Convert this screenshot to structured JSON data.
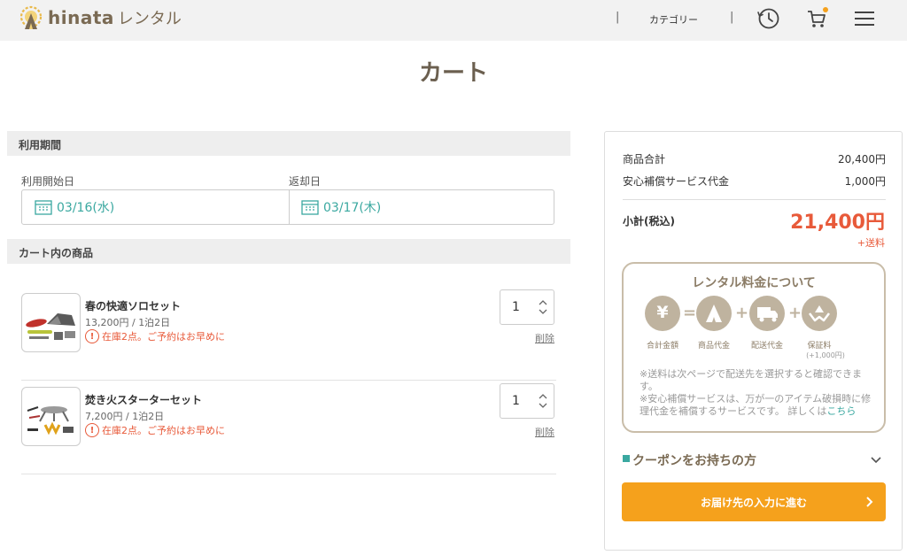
{
  "header": {
    "logo_text": "hinata",
    "logo_sub": "レンタル",
    "separator": "|",
    "category_label": "カテゴリー"
  },
  "page_title": "カート",
  "period": {
    "section_title": "利用期間",
    "start_label": "利用開始日",
    "start_value": "03/16(水)",
    "end_label": "返却日",
    "end_value": "03/17(木)"
  },
  "cart": {
    "section_title": "カート内の商品",
    "items": [
      {
        "name": "春の快適ソロセット",
        "price": "13,200円 / 1泊2日",
        "stock": "在庫2点。ご予約はお早めに",
        "qty": "1",
        "delete_label": "削除"
      },
      {
        "name": "焚き火スターターセット",
        "price": "7,200円 / 1泊2日",
        "stock": "在庫2点。ご予約はお早めに",
        "qty": "1",
        "delete_label": "削除"
      }
    ]
  },
  "summary": {
    "product_total_label": "商品合計",
    "product_total_value": "20,400円",
    "insurance_label": "安心補償サービス代金",
    "insurance_value": "1,000円",
    "subtotal_label": "小計(税込)",
    "subtotal_value": "21,400円",
    "shipping_note": "+送料",
    "rental_info": {
      "title": "レンタル料金について",
      "labels": [
        "合計金額",
        "商品代金",
        "配送代金",
        "保証料"
      ],
      "insurance_sub": "(+1,000円)",
      "symbol_yen": "¥",
      "op_equals": "=",
      "op_plus": "+",
      "note1": "※送料は次ページで配送先を選択すると確認できます。",
      "note2": "※安心補償サービスは、万が一のアイテム破損時に修理代金を補償するサービスです。 詳しくは",
      "note2_link": "こちら"
    },
    "coupon_label": "クーポンをお持ちの方",
    "cta_label": "お届け先の入力に進む"
  },
  "colors": {
    "accent_orange": "#f5a11c",
    "price_red": "#e85a3a",
    "teal": "#3aa8a0",
    "brown": "#7a6a53"
  }
}
